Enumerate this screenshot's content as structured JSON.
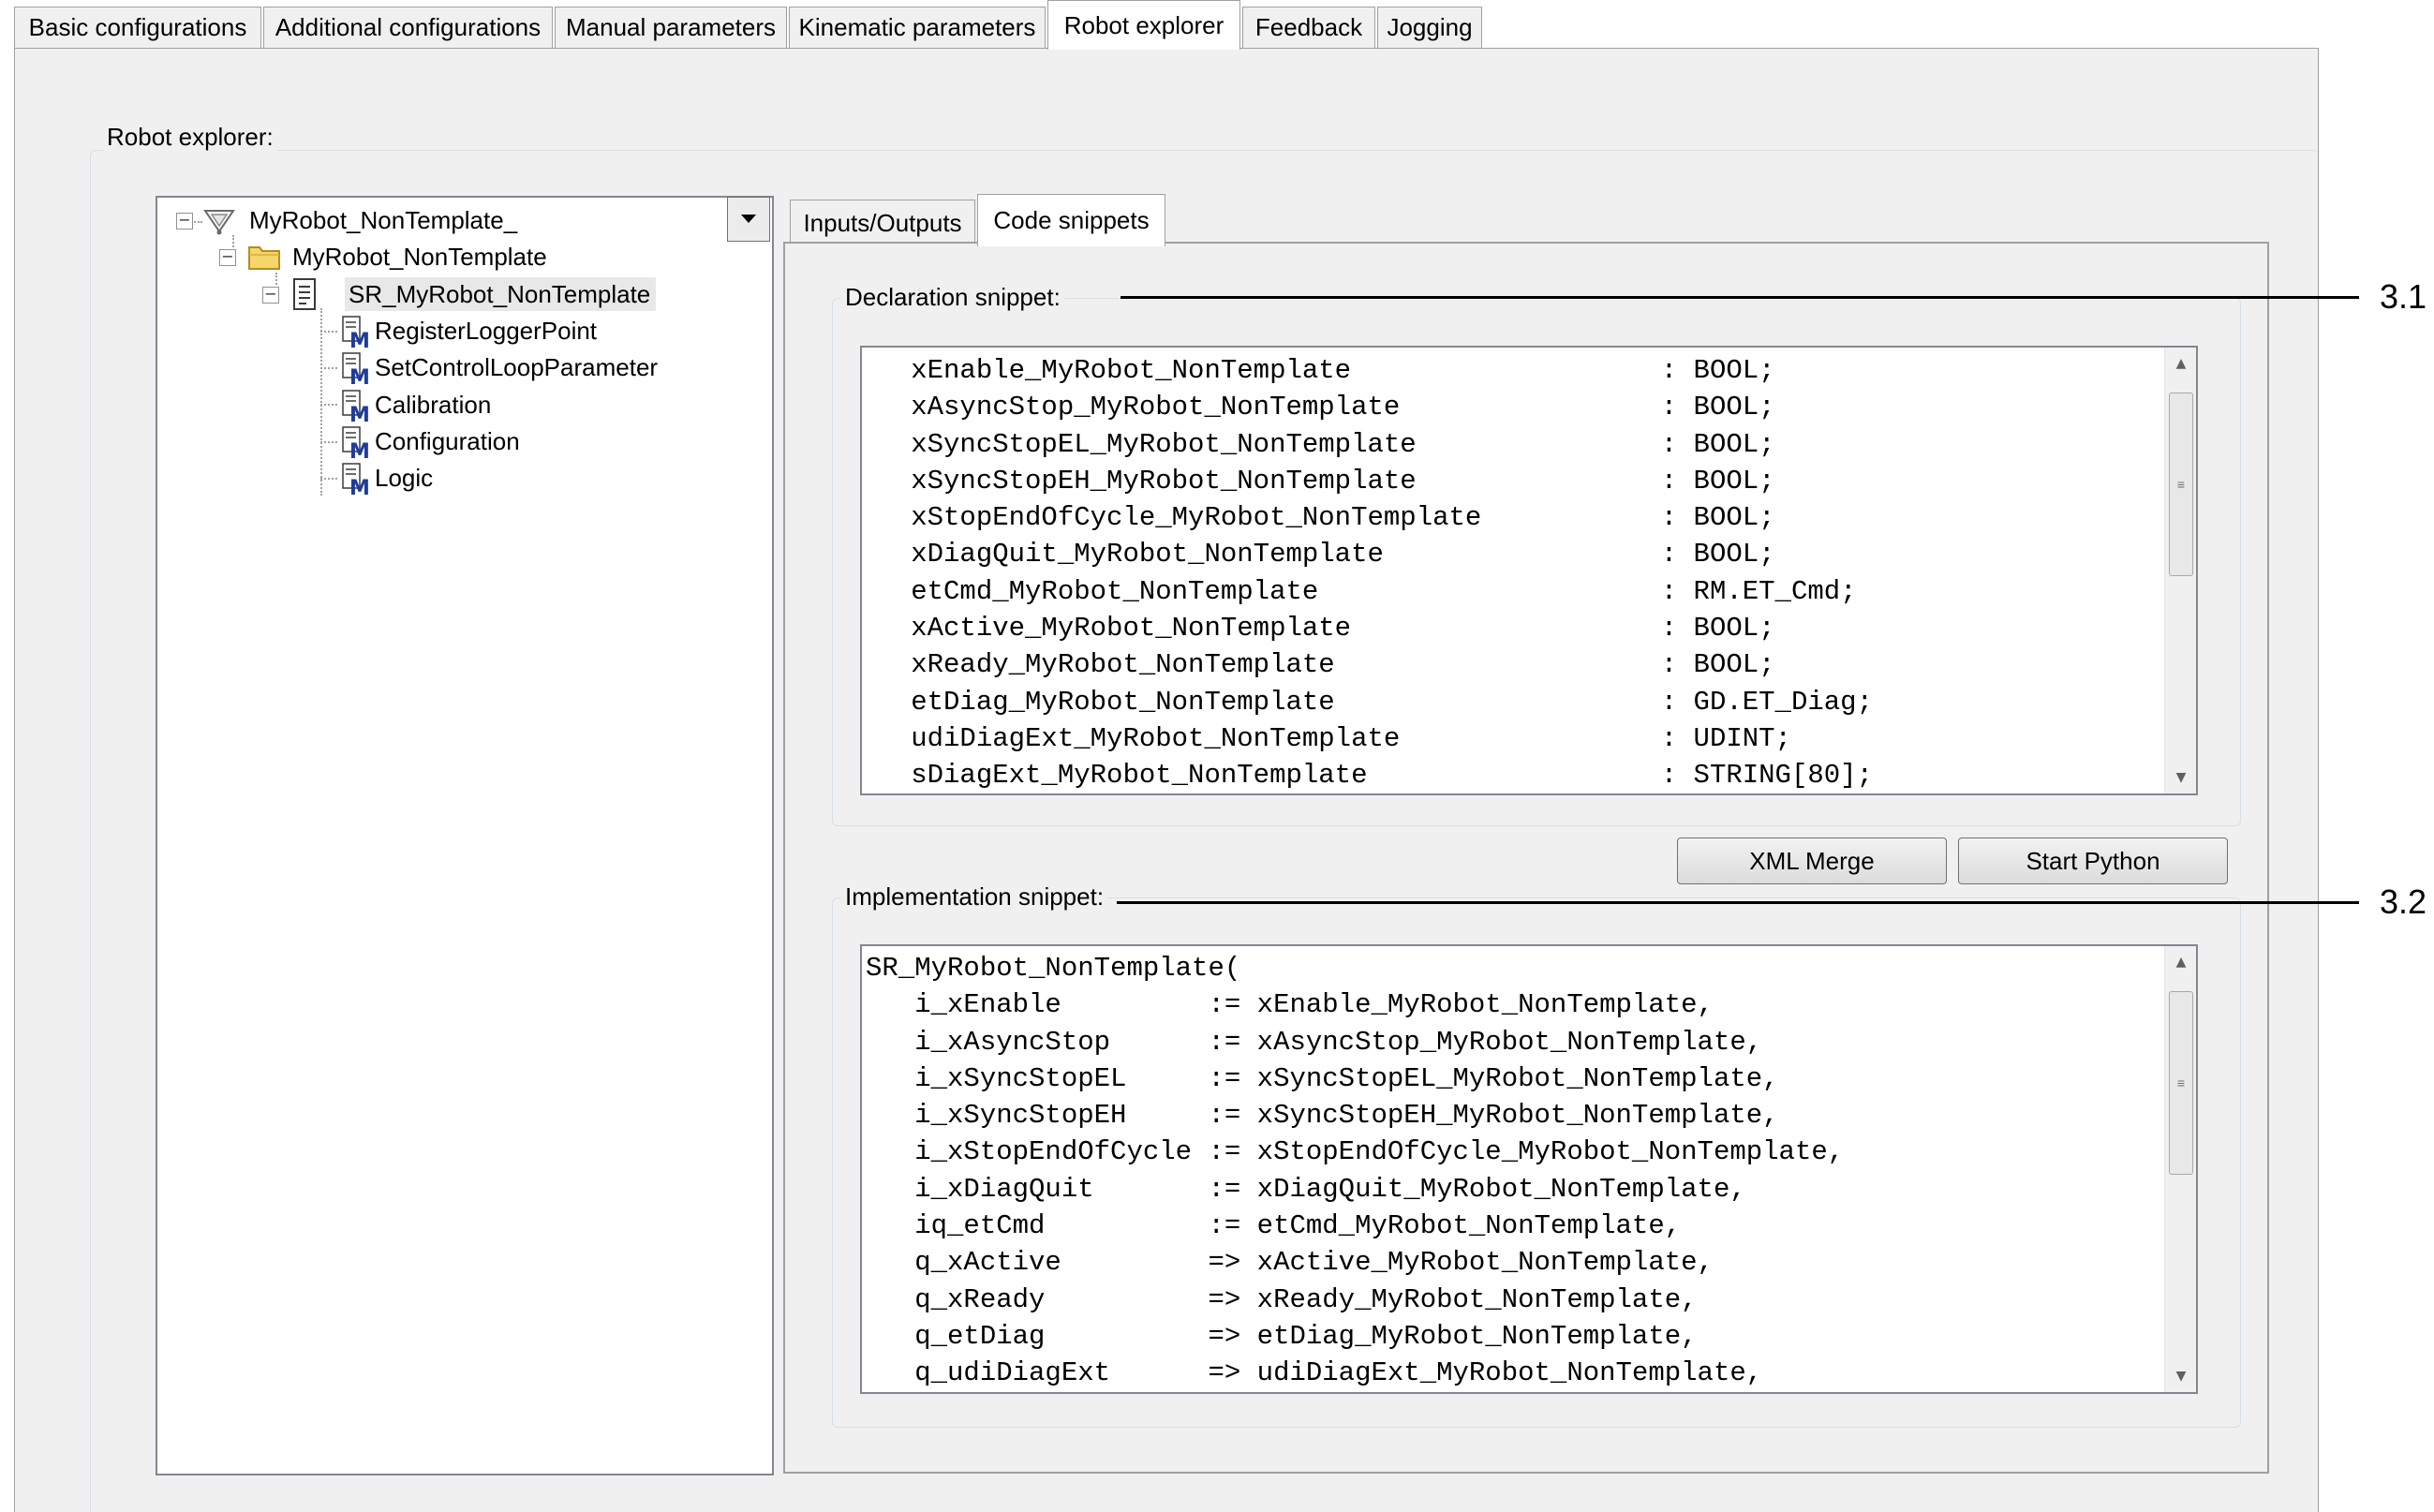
{
  "top_tabs": [
    {
      "label": "Basic configurations"
    },
    {
      "label": "Additional configurations"
    },
    {
      "label": "Manual parameters"
    },
    {
      "label": "Kinematic parameters"
    },
    {
      "label": "Robot explorer"
    },
    {
      "label": "Feedback"
    },
    {
      "label": "Jogging"
    }
  ],
  "active_top_tab": "Robot explorer",
  "robot_explorer": {
    "group_label": "Robot explorer:",
    "tree": {
      "root": "MyRobot_NonTemplate_",
      "folder": "MyRobot_NonTemplate",
      "selected_item": "SR_MyRobot_NonTemplate",
      "methods": [
        "RegisterLoggerPoint",
        "SetControlLoopParameter",
        "Calibration",
        "Configuration",
        "Logic"
      ]
    },
    "inner_tabs": [
      {
        "label": "Inputs/Outputs"
      },
      {
        "label": "Code snippets"
      }
    ],
    "active_inner_tab": "Code snippets",
    "declaration": {
      "label": "Declaration snippet:",
      "lines": [
        "   xEnable_MyRobot_NonTemplate                   : BOOL;",
        "   xAsyncStop_MyRobot_NonTemplate                : BOOL;",
        "   xSyncStopEL_MyRobot_NonTemplate               : BOOL;",
        "   xSyncStopEH_MyRobot_NonTemplate               : BOOL;",
        "   xStopEndOfCycle_MyRobot_NonTemplate           : BOOL;",
        "   xDiagQuit_MyRobot_NonTemplate                 : BOOL;",
        "   etCmd_MyRobot_NonTemplate                     : RM.ET_Cmd;",
        "   xActive_MyRobot_NonTemplate                   : BOOL;",
        "   xReady_MyRobot_NonTemplate                    : BOOL;",
        "   etDiag_MyRobot_NonTemplate                    : GD.ET_Diag;",
        "   udiDiagExt_MyRobot_NonTemplate                : UDINT;",
        "   sDiagExt_MyRobot_NonTemplate                  : STRING[80];"
      ]
    },
    "buttons": {
      "xml_merge": "XML Merge",
      "start_python": "Start Python"
    },
    "implementation": {
      "label": "Implementation snippet:",
      "lines": [
        "SR_MyRobot_NonTemplate(",
        "   i_xEnable         := xEnable_MyRobot_NonTemplate,",
        "   i_xAsyncStop      := xAsyncStop_MyRobot_NonTemplate,",
        "   i_xSyncStopEL     := xSyncStopEL_MyRobot_NonTemplate,",
        "   i_xSyncStopEH     := xSyncStopEH_MyRobot_NonTemplate,",
        "   i_xStopEndOfCycle := xStopEndOfCycle_MyRobot_NonTemplate,",
        "   i_xDiagQuit       := xDiagQuit_MyRobot_NonTemplate,",
        "   iq_etCmd          := etCmd_MyRobot_NonTemplate,",
        "   q_xActive         => xActive_MyRobot_NonTemplate,",
        "   q_xReady          => xReady_MyRobot_NonTemplate,",
        "   q_etDiag          => etDiag_MyRobot_NonTemplate,",
        "   q_udiDiagExt      => udiDiagExt_MyRobot_NonTemplate,"
      ]
    }
  },
  "callouts": {
    "declaration": "3.1",
    "implementation": "3.2"
  },
  "colors": {
    "panel_bg": "#f0f0f0",
    "selection_bg": "#e8e8e8",
    "border": "#a0a0a0",
    "method_icon": "#1e3c9c"
  }
}
